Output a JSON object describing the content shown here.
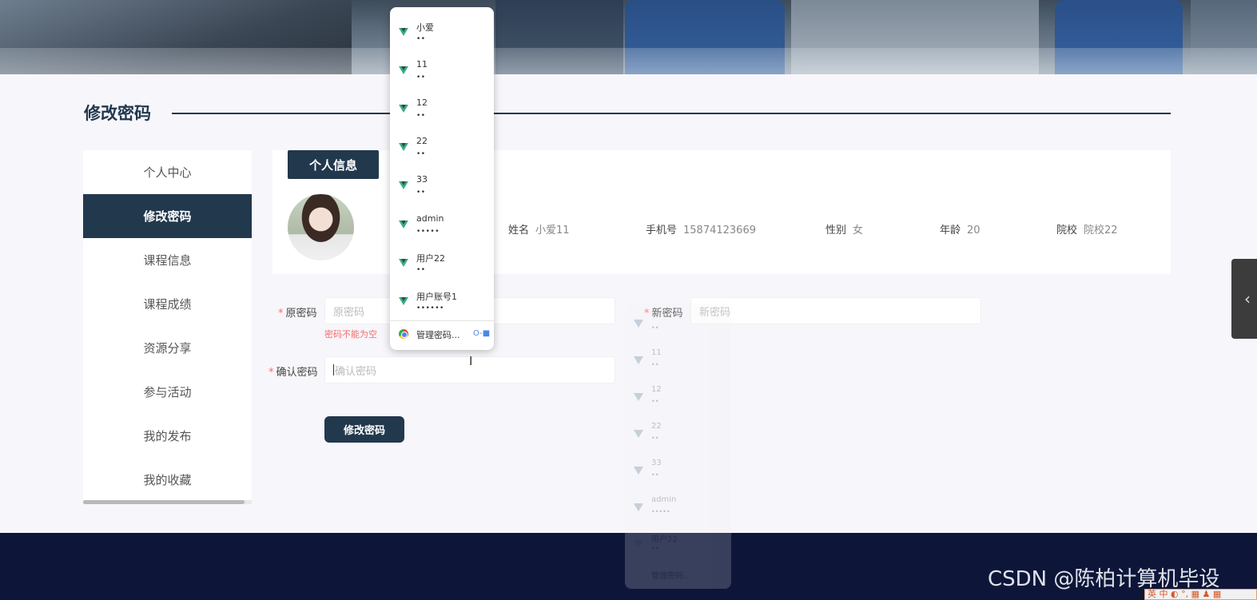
{
  "banner": {
    "image": "classroom-photo"
  },
  "page": {
    "title": "修改密码"
  },
  "sidebar": {
    "items": [
      {
        "label": "个人中心"
      },
      {
        "label": "修改密码"
      },
      {
        "label": "课程信息"
      },
      {
        "label": "课程成绩"
      },
      {
        "label": "资源分享"
      },
      {
        "label": "参与活动"
      },
      {
        "label": "我的发布"
      },
      {
        "label": "我的收藏"
      }
    ],
    "active_index": 1
  },
  "profile": {
    "tab_label": "个人信息",
    "fields": [
      {
        "label": "姓名",
        "value": "小爱11"
      },
      {
        "label": "手机号",
        "value": "15874123669"
      },
      {
        "label": "性别",
        "value": "女"
      },
      {
        "label": "年龄",
        "value": "20"
      },
      {
        "label": "院校",
        "value": "院校22"
      }
    ]
  },
  "form": {
    "old_password": {
      "label": "原密码",
      "placeholder": "原密码",
      "error": "密码不能为空"
    },
    "new_password": {
      "label": "新密码",
      "placeholder": "新密码"
    },
    "confirm_password": {
      "label": "确认密码",
      "placeholder": "确认密码"
    },
    "required_mark": "*",
    "submit_label": "修改密码"
  },
  "autofill": {
    "entries": [
      {
        "username": "小爱",
        "password": "••"
      },
      {
        "username": "11",
        "password": "••"
      },
      {
        "username": "12",
        "password": "••"
      },
      {
        "username": "22",
        "password": "••"
      },
      {
        "username": "33",
        "password": "••"
      },
      {
        "username": "admin",
        "password": "•••••"
      },
      {
        "username": "用户22",
        "password": "••"
      },
      {
        "username": "用户账号1",
        "password": "••••••"
      }
    ],
    "manage_label": "管理密码...",
    "ghost_entries": [
      {
        "username": "",
        "password": "••"
      },
      {
        "username": "11",
        "password": "••"
      },
      {
        "username": "12",
        "password": "••"
      },
      {
        "username": "22",
        "password": "••"
      },
      {
        "username": "33",
        "password": "••"
      },
      {
        "username": "admin",
        "password": "•••••"
      },
      {
        "username": "用户22",
        "password": "••"
      }
    ],
    "ghost_manage_label": "管理密码..."
  },
  "footer": {
    "watermark": "CSDN @陈柏计算机毕设"
  },
  "ime": {
    "text": "英 中 ◐ °, ▦ ♟ ▦"
  },
  "colors": {
    "primary": "#22384d",
    "error": "#f56c6c",
    "footer": "#0d1639",
    "vue_green": "#3aae80"
  }
}
